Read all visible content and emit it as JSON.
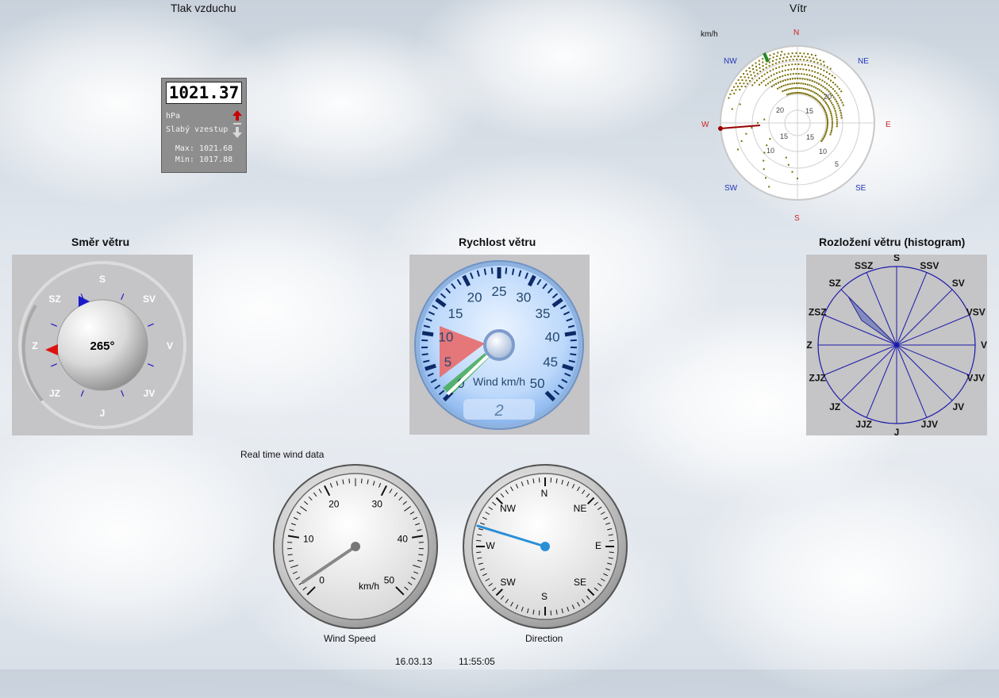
{
  "pressure": {
    "title": "Tlak vzduchu",
    "value": "1021.37",
    "unit": "hPa",
    "trend": "Slabý vzestup",
    "max": "Max: 1021.68",
    "min": "Min: 1017.88",
    "trend_up_color": "#cc0000",
    "trend_down_color": "#d8d8d8"
  },
  "wind_rose": {
    "title": "Vítr",
    "unit": "km/h",
    "directions": [
      "N",
      "NE",
      "E",
      "SE",
      "S",
      "SW",
      "W",
      "NW"
    ],
    "ring_labels": [
      "20",
      "15",
      "10",
      "5"
    ],
    "direction_color": "#2233bb",
    "ns_color": "#cc2222",
    "dot_color": "#7a6e00"
  },
  "wind_direction": {
    "title": "Směr větru",
    "value": "265°",
    "labels": [
      "S",
      "SV",
      "V",
      "JV",
      "J",
      "JZ",
      "Z",
      "SZ"
    ]
  },
  "wind_speed": {
    "title": "Rychlost větru",
    "ticks": [
      "0",
      "5",
      "10",
      "15",
      "20",
      "25",
      "30",
      "35",
      "40",
      "45",
      "50"
    ],
    "label": "Wind km/h",
    "readout": "2",
    "value_kmh": 2
  },
  "histogram": {
    "title": "Rozložení větru (histogram)",
    "labels": [
      "S",
      "SSV",
      "SV",
      "VSV",
      "V",
      "VJV",
      "JV",
      "JJV",
      "J",
      "JJZ",
      "JZ",
      "ZJZ",
      "Z",
      "ZSZ",
      "SZ",
      "SSZ"
    ]
  },
  "realtime": {
    "caption": "Real time wind data",
    "speed_gauge": {
      "ticks": [
        "0",
        "10",
        "20",
        "30",
        "40",
        "50"
      ],
      "unit": "km/h",
      "caption": "Wind Speed",
      "value_kmh": 2
    },
    "direction_gauge": {
      "labels": [
        "N",
        "NE",
        "E",
        "SE",
        "S",
        "SW",
        "W",
        "NW"
      ],
      "caption": "Direction",
      "value_deg": 287
    }
  },
  "footer": {
    "date": "16.03.13",
    "time": "11:55:05"
  }
}
